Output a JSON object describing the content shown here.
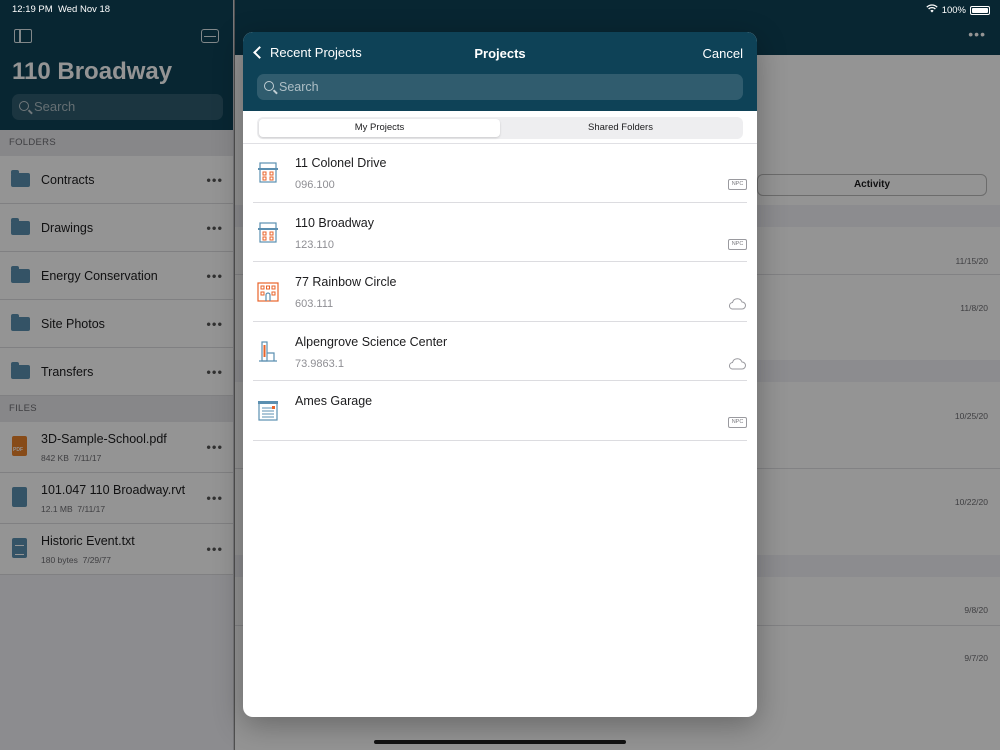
{
  "status_bar": {
    "time": "12:19 PM",
    "date": "Wed Nov 18",
    "battery": "100%"
  },
  "sidebar": {
    "title": "110 Broadway",
    "search_placeholder": "Search",
    "folders_label": "FOLDERS",
    "folders": [
      {
        "label": "Contracts"
      },
      {
        "label": "Drawings"
      },
      {
        "label": "Energy Conservation"
      },
      {
        "label": "Site Photos"
      },
      {
        "label": "Transfers"
      }
    ],
    "files_label": "FILES",
    "files": [
      {
        "name": "3D-Sample-School.pdf",
        "size": "842 KB",
        "date": "7/11/17",
        "type": "pdf"
      },
      {
        "name": "101.047 110 Broadway.rvt",
        "size": "12.1 MB",
        "date": "7/11/17",
        "type": "rvt"
      },
      {
        "name": "Historic Event.txt",
        "size": "180 bytes",
        "date": "7/29/77",
        "type": "txt"
      }
    ]
  },
  "main": {
    "segment_label": "Activity",
    "dates": [
      "11/15/20",
      "11/8/20",
      "10/25/20",
      "10/22/20",
      "9/8/20",
      "9/7/20"
    ]
  },
  "modal": {
    "back_label": "Recent Projects",
    "title": "Projects",
    "cancel_label": "Cancel",
    "search_placeholder": "Search",
    "tabs": [
      {
        "label": "My Projects",
        "active": true
      },
      {
        "label": "Shared Folders",
        "active": false
      }
    ],
    "projects": [
      {
        "name": "11 Colonel Drive",
        "number": "096.100",
        "badge": "NPC",
        "icon": "building-icon"
      },
      {
        "name": "110 Broadway",
        "number": "123.110",
        "badge": "NPC",
        "icon": "building-icon"
      },
      {
        "name": "77 Rainbow Circle",
        "number": "603.111",
        "badge": "cloud",
        "icon": "house-icon"
      },
      {
        "name": "Alpengrove Science Center",
        "number": "73.9863.1",
        "badge": "cloud",
        "icon": "tower-icon"
      },
      {
        "name": "Ames Garage",
        "number": "",
        "badge": "NPC",
        "icon": "garage-icon"
      }
    ]
  },
  "colors": {
    "header": "#0e4257",
    "accent_orange": "#e8632a",
    "icon_blue": "#5b8fb0"
  }
}
